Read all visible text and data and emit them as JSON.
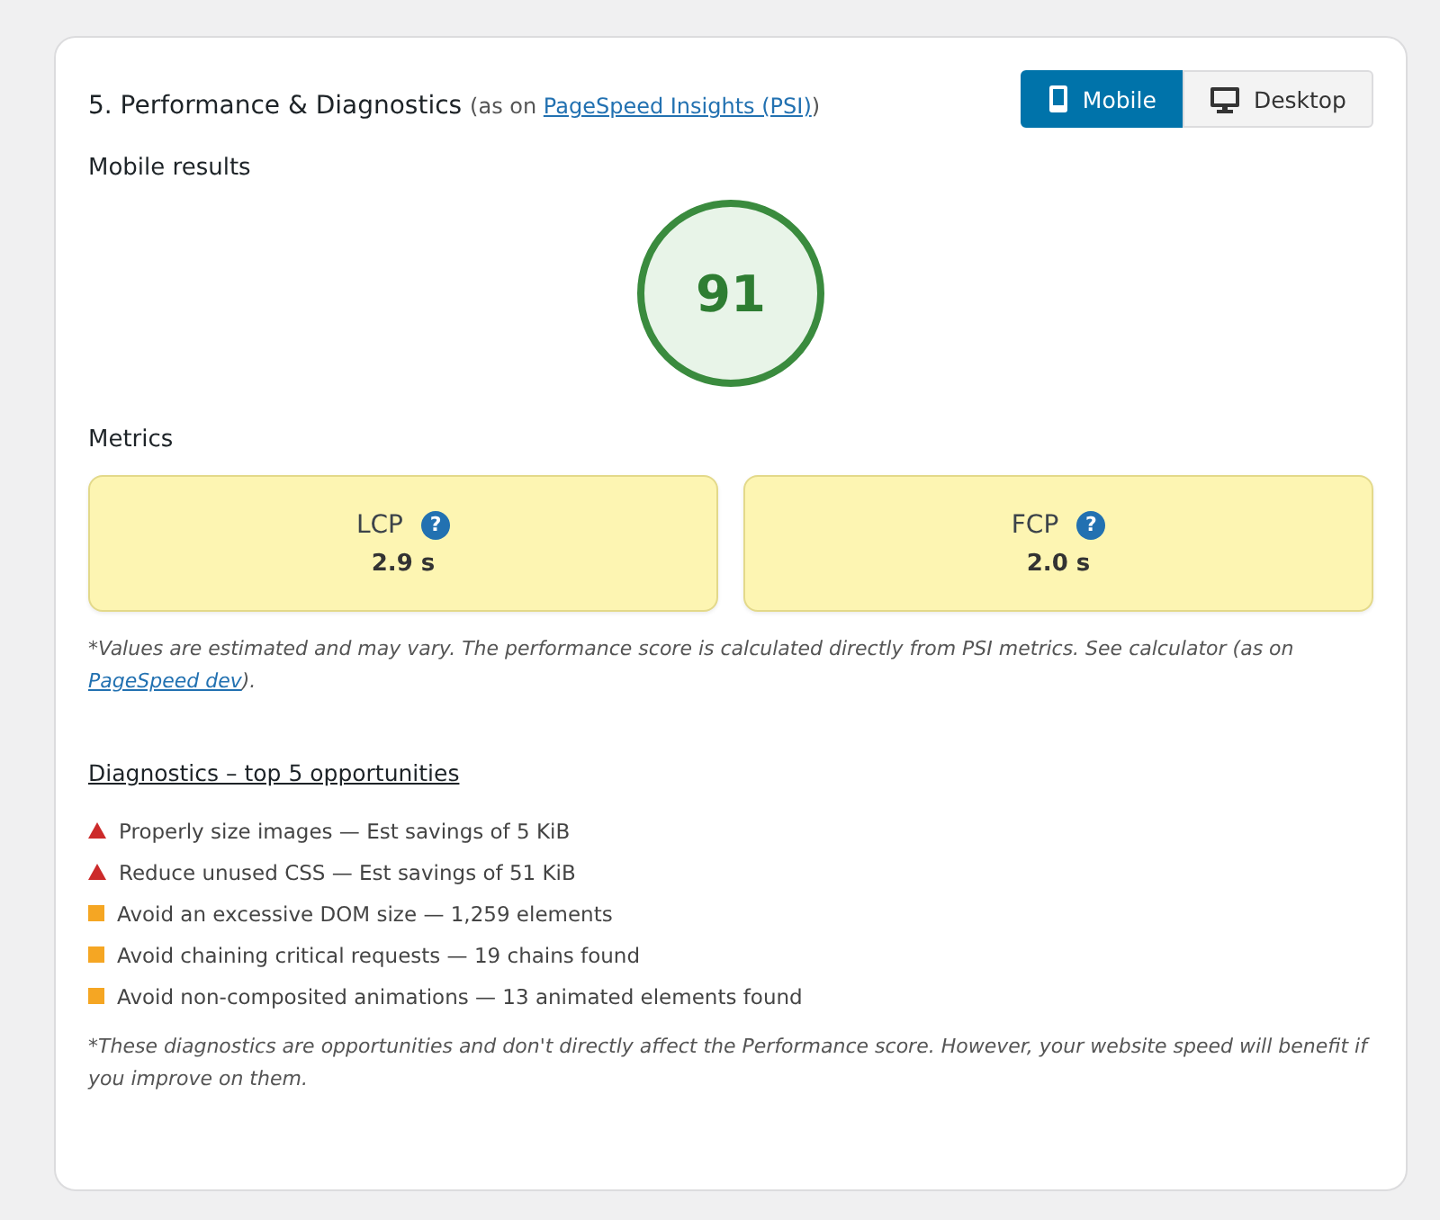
{
  "header": {
    "title": "5. Performance & Diagnostics",
    "source_before": "(as on ",
    "source_link": "PageSpeed Insights (PSI)",
    "source_after": ")"
  },
  "device_tabs": [
    {
      "label": "Mobile",
      "kind": "mobile",
      "selected": true
    },
    {
      "label": "Desktop",
      "kind": "desktop",
      "selected": false
    }
  ],
  "results_heading": "Mobile results",
  "score": "91",
  "metrics_heading": "Metrics",
  "metrics": [
    {
      "name": "LCP",
      "help": "?",
      "value": "2.9 s"
    },
    {
      "name": "FCP",
      "help": "?",
      "value": "2.0 s"
    }
  ],
  "metrics_note": {
    "before": "*Values are estimated and may vary. The performance score is calculated directly from PSI metrics. See calculator (as on ",
    "link": "PageSpeed dev",
    "after": ")."
  },
  "diagnostics_heading": "Diagnostics – top 5 opportunities",
  "diagnostics": [
    {
      "kind": "fail",
      "text": "Properly size images — Est savings of 5 KiB"
    },
    {
      "kind": "fail",
      "text": "Reduce unused CSS — Est savings of 51 KiB"
    },
    {
      "kind": "warn",
      "text": "Avoid an excessive DOM size — 1,259 elements"
    },
    {
      "kind": "warn",
      "text": "Avoid chaining critical requests — 19 chains found"
    },
    {
      "kind": "warn",
      "text": "Avoid non-composited animations — 13 animated elements found"
    }
  ],
  "diagnostics_note": "*These diagnostics are opportunities and don't directly affect the Performance score. However, your website speed will benefit if you improve on them."
}
